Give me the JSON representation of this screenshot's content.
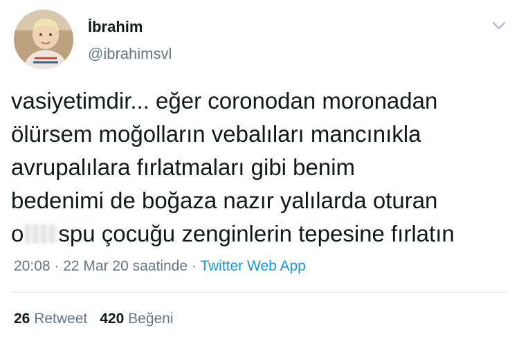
{
  "user": {
    "display_name": "İbrahim",
    "handle": "@ibrahimsvl"
  },
  "tweet": {
    "lines": [
      "vasiyetimdir... eğer coronodan moronadan",
      "ölürsem moğolların vebalıları mancınıkla",
      "avrupalılara fırlatmaları gibi benim",
      "bedenimi de boğaza nazır yalılarda oturan"
    ],
    "last_line_prefix": "o",
    "last_line_suffix": "spu çocuğu zenginlerin tepesine fırlatın"
  },
  "meta": {
    "time": "20:08",
    "separator": " · ",
    "date": "22 Mar 20 saatinde",
    "source": "Twitter Web App"
  },
  "stats": {
    "retweet_count": "26",
    "retweet_label": "Retweet",
    "like_count": "420",
    "like_label": "Beğeni"
  },
  "icons": {
    "menu": "chevron-down-icon"
  },
  "colors": {
    "text": "#14171a",
    "secondary": "#657786",
    "link": "#1b95e0",
    "divider": "#e6ecf0"
  }
}
